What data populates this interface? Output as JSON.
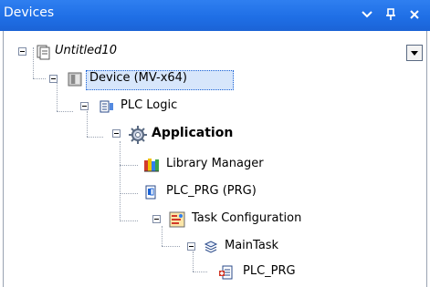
{
  "window": {
    "title": "Devices",
    "buttons": {
      "dropdown": "▾",
      "pin": "ᵖ",
      "close": "✕"
    }
  },
  "tree": {
    "items": [
      {
        "label": "Untitled10",
        "icon": "project-icon",
        "italic": true
      },
      {
        "label": "Device (MV-x64)",
        "icon": "device-icon",
        "selected": true
      },
      {
        "label": "PLC Logic",
        "icon": "plc-logic-icon"
      },
      {
        "label": "Application",
        "icon": "application-gear-icon",
        "bold": true
      },
      {
        "label": "Library Manager",
        "icon": "library-books-icon"
      },
      {
        "label": "PLC_PRG (PRG)",
        "icon": "program-icon"
      },
      {
        "label": "Task Configuration",
        "icon": "task-configuration-icon"
      },
      {
        "label": "MainTask",
        "icon": "task-icon"
      },
      {
        "label": "PLC_PRG",
        "icon": "program-call-icon"
      }
    ]
  },
  "colors": {
    "titlebar": "#1f6fe6",
    "selection_bg": "#d7e6fb",
    "selection_border": "#1b63d6"
  }
}
